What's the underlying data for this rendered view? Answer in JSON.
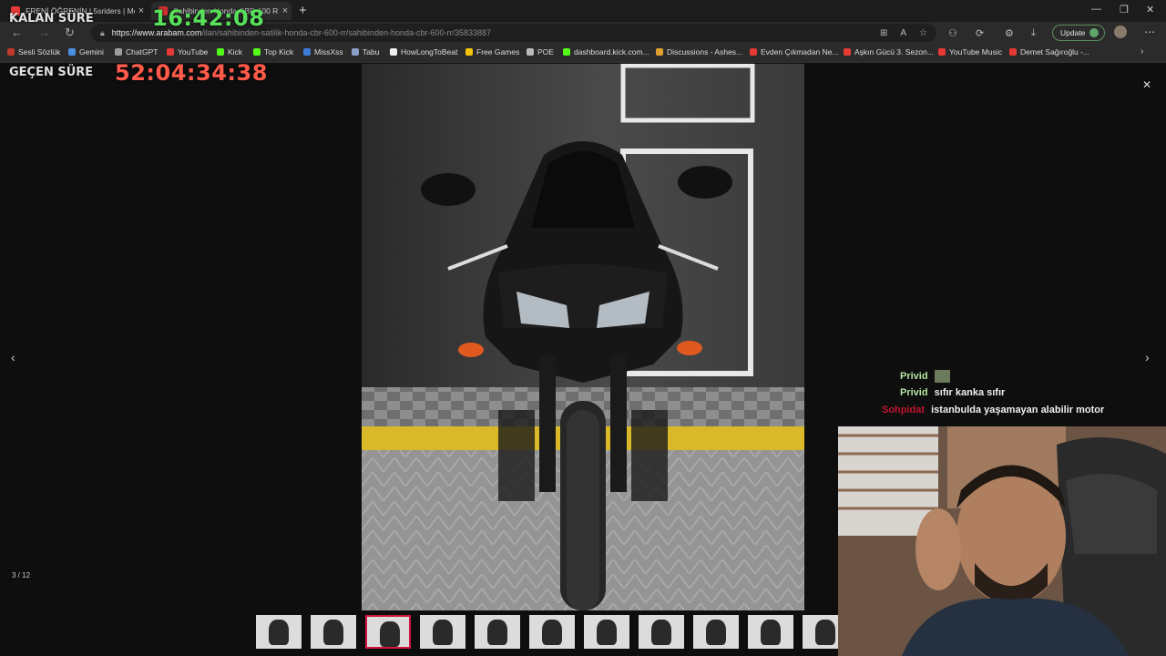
{
  "tabs": [
    {
      "title": "FRENİ ÖĞRENİN | 5sriders | Moto",
      "active": false
    },
    {
      "title": "Sahibinden Honda CBR 600 RR 20",
      "active": true
    }
  ],
  "address": {
    "host": "https://www.arabam.com",
    "path": "/ilan/sahibinden-satilik-honda-cbr-600-rr/sahibinden-honda-cbr-600-rr/35833887"
  },
  "toolbar": {
    "update_label": "Update"
  },
  "bookmarks": [
    {
      "label": "Sesli Sözlük",
      "color": "#c0392b"
    },
    {
      "label": "Gemini",
      "color": "#4a90e2"
    },
    {
      "label": "ChatGPT",
      "color": "#9e9e9e"
    },
    {
      "label": "YouTube",
      "color": "#e53935"
    },
    {
      "label": "Kick",
      "color": "#53fc18"
    },
    {
      "label": "Top Kick",
      "color": "#53fc18"
    },
    {
      "label": "MissXss",
      "color": "#3f7bd9"
    },
    {
      "label": "Tabu",
      "color": "#8aa0c8"
    },
    {
      "label": "HowLongToBeat",
      "color": "#f0f0f0"
    },
    {
      "label": "Free Games",
      "color": "#f4c20d"
    },
    {
      "label": "POE",
      "color": "#bbbbbb"
    },
    {
      "label": "dashboard.kick.com...",
      "color": "#53fc18"
    },
    {
      "label": "Discussions - Ashes...",
      "color": "#e0a030"
    },
    {
      "label": "Evden Çıkmadan Ne...",
      "color": "#e53935"
    },
    {
      "label": "Aşkın Gücü 3. Sezon...",
      "color": "#e53935"
    },
    {
      "label": "YouTube Music",
      "color": "#e53935"
    },
    {
      "label": "Demet Sağıroğlu -...",
      "color": "#e53935"
    }
  ],
  "overlay": {
    "remaining_label": "KALAN SÜRE",
    "remaining_time": "16:42:08",
    "elapsed_label": "GEÇEN SÜRE",
    "elapsed_time": "52:04:34:38",
    "remaining_color": "#58e05a",
    "elapsed_color": "#ff5a4a"
  },
  "gallery": {
    "counter": "3 / 12",
    "thumbnail_count": 11,
    "selected_index": 2
  },
  "chat": [
    {
      "user": "Privid",
      "text": "",
      "user_color": "#b5e3a0",
      "emote": true
    },
    {
      "user": "Privid",
      "text": "sıfır kanka sıfır",
      "user_color": "#b5e3a0",
      "emote": false
    },
    {
      "user": "Sohpidat",
      "text": "istanbulda yaşamayan alabilir motor",
      "user_color": "#c0152f",
      "emote": false
    }
  ]
}
